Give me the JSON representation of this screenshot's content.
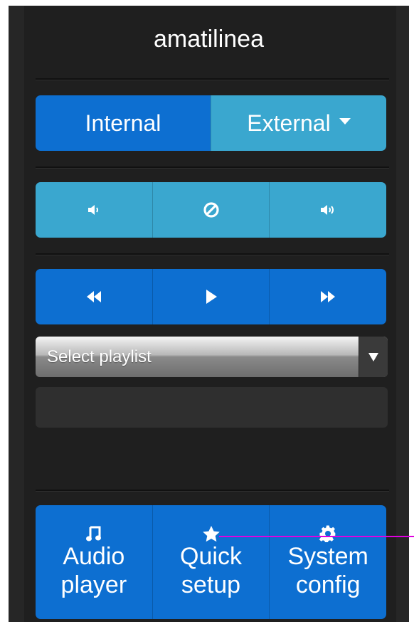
{
  "header": {
    "title": "amatilinea"
  },
  "source": {
    "internal_label": "Internal",
    "external_label": "External"
  },
  "volume": {
    "down": "volume-down-icon",
    "mute": "mute-icon",
    "up": "volume-up-icon"
  },
  "transport": {
    "previous": "rewind-icon",
    "play": "play-icon",
    "next": "fast-forward-icon"
  },
  "playlist": {
    "selected": "Select playlist",
    "text_value": ""
  },
  "nav": {
    "items": [
      {
        "icon": "music-note-icon",
        "line1": "Audio",
        "line2": "player"
      },
      {
        "icon": "star-icon",
        "line1": "Quick",
        "line2": "setup"
      },
      {
        "icon": "gear-icon",
        "line1": "System",
        "line2": "config"
      }
    ]
  },
  "colors": {
    "primary": "#0d6fd1",
    "secondary": "#3aa7cf",
    "background": "#1f1f1f",
    "annotation": "#e000e0"
  }
}
